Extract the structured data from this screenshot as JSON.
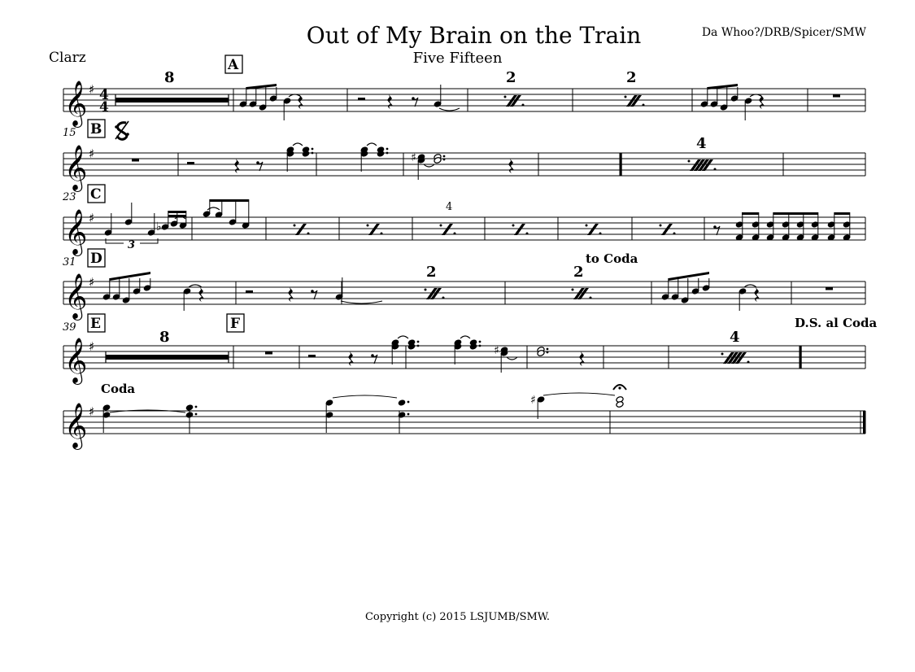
{
  "score": {
    "title": "Out of My Brain on the Train",
    "subtitle": "Five Fifteen",
    "composer": "Da Whoo?/DRB/Spicer/SMW",
    "instrument": "Clarz",
    "copyright": "Copyright (c) 2015 LSJUMB/SMW."
  },
  "time_signature": {
    "top": "4",
    "bottom": "4"
  },
  "rehearsal_marks": {
    "a": "A",
    "b": "B",
    "c": "C",
    "d": "D",
    "e": "E",
    "f": "F"
  },
  "measure_numbers": {
    "system2": "15",
    "system3": "23",
    "system4": "31",
    "system5": "39"
  },
  "multirest_counts": {
    "s1": "8",
    "s5": "8"
  },
  "repeat_counts": {
    "s1a": "2",
    "s1b": "2",
    "s2": "4",
    "s3": "4",
    "s4a": "2",
    "s4b": "2",
    "s5": "4"
  },
  "tuplet": "3",
  "directions": {
    "to_coda": "to Coda",
    "ds_al_coda": "D.S. al Coda",
    "coda": "Coda"
  },
  "icons": {
    "treble_clef": "treble-clef-icon",
    "segno": "segno-icon",
    "sharp": "sharp-icon",
    "fermata": "fermata-icon"
  }
}
